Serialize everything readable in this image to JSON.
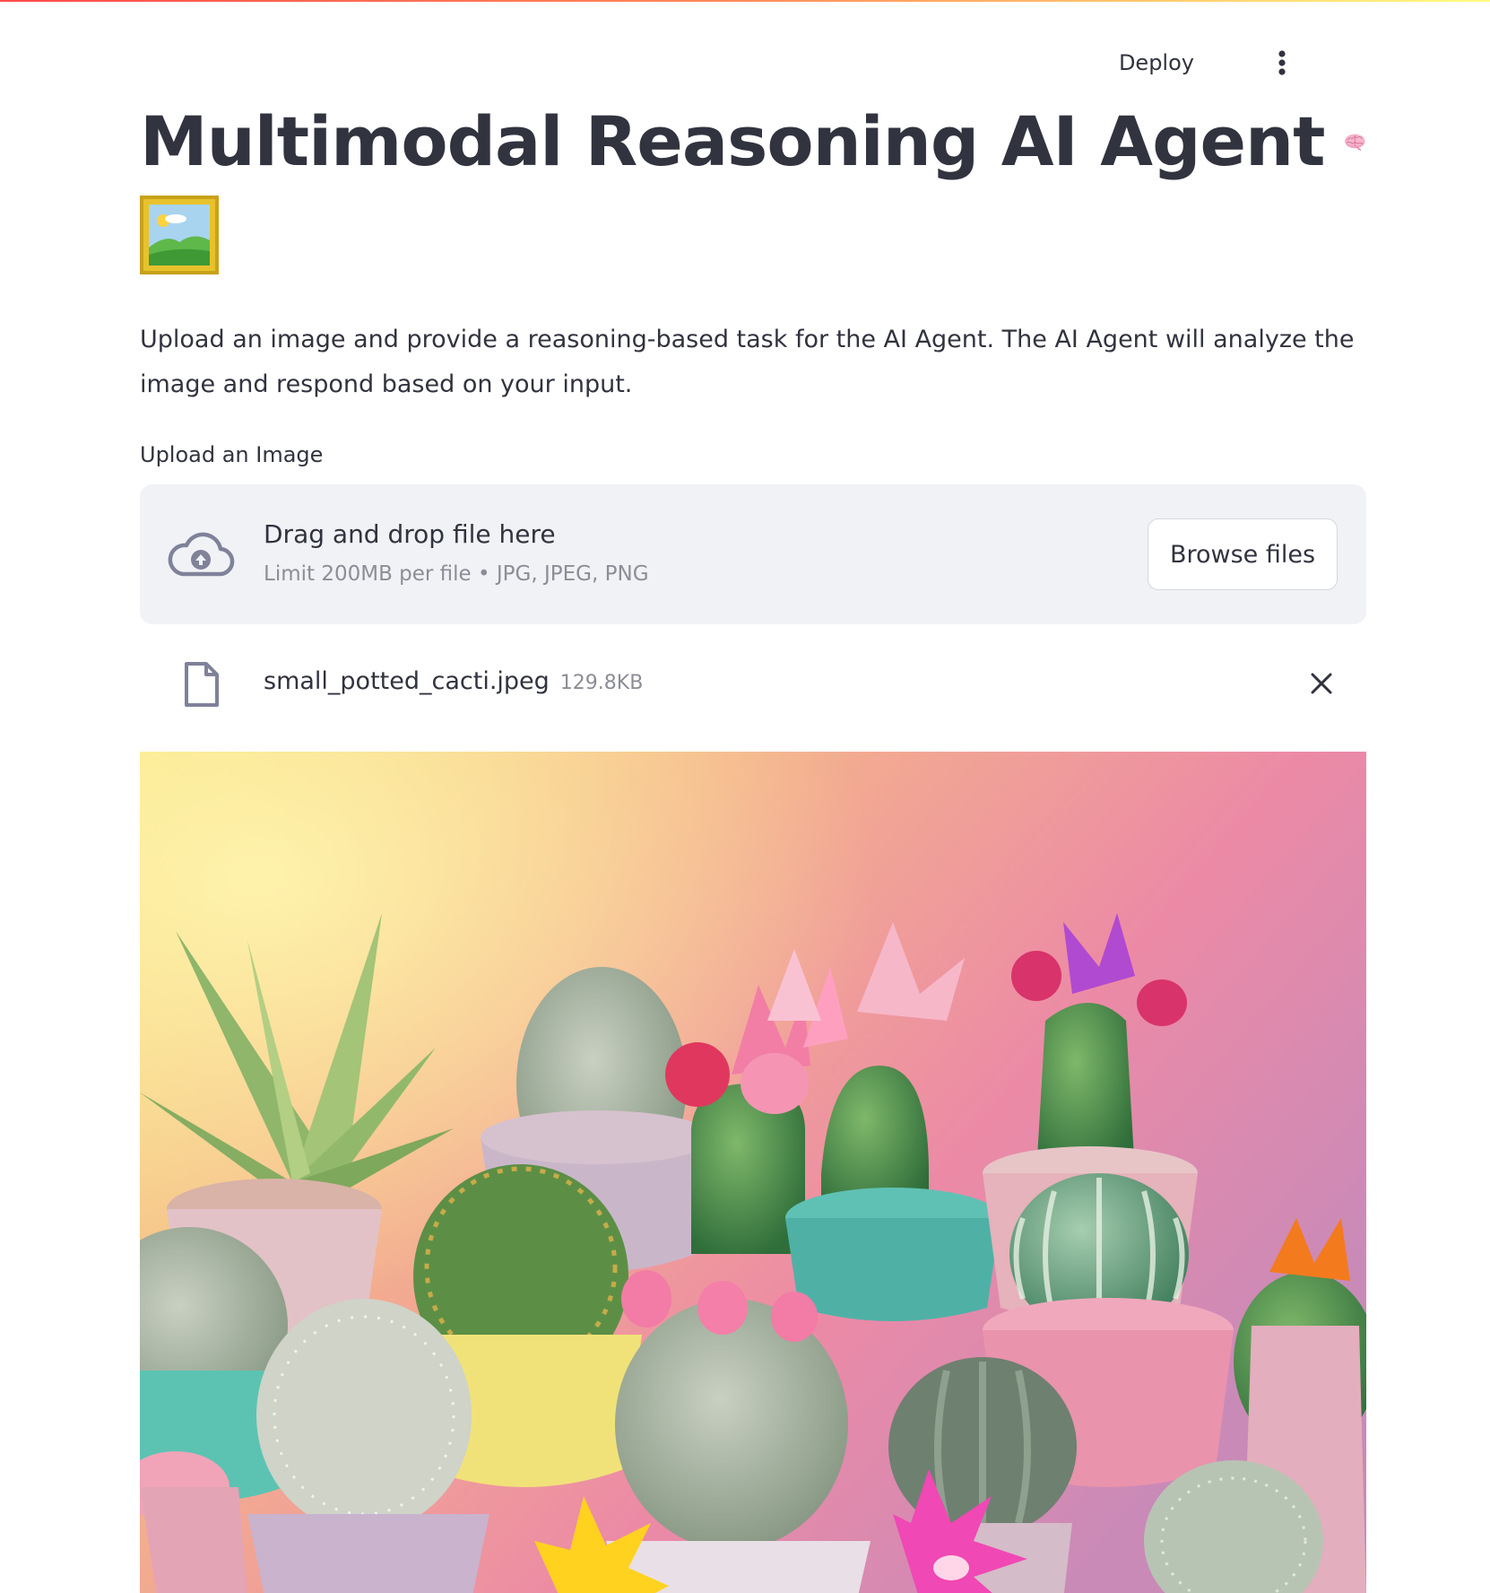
{
  "header": {
    "deploy_label": "Deploy",
    "menu_icon": "more-vertical-icon"
  },
  "page": {
    "title": "Multimodal Reasoning AI Agent",
    "title_emoji_1": "brain-icon",
    "title_emoji_2": "framed-picture-icon",
    "description": "Upload an image and provide a reasoning-based task for the AI Agent. The AI Agent will analyze the image and respond based on your input."
  },
  "uploader": {
    "label": "Upload an Image",
    "drop_text": "Drag and drop file here",
    "limit_text": "Limit 200MB per file • JPG, JPEG, PNG",
    "browse_label": "Browse files",
    "icon": "cloud-upload-icon"
  },
  "uploaded_file": {
    "name": "small_potted_cacti.jpeg",
    "size": "129.8KB",
    "icon": "file-icon",
    "remove_icon": "close-icon"
  },
  "preview": {
    "subject": "potted-cacti-photo"
  },
  "colors": {
    "accent_gradient": [
      "#ff4b4b",
      "#fffd80"
    ],
    "text": "#31333f",
    "muted": "#8c8d96",
    "dropzone_bg": "#f0f2f6"
  }
}
